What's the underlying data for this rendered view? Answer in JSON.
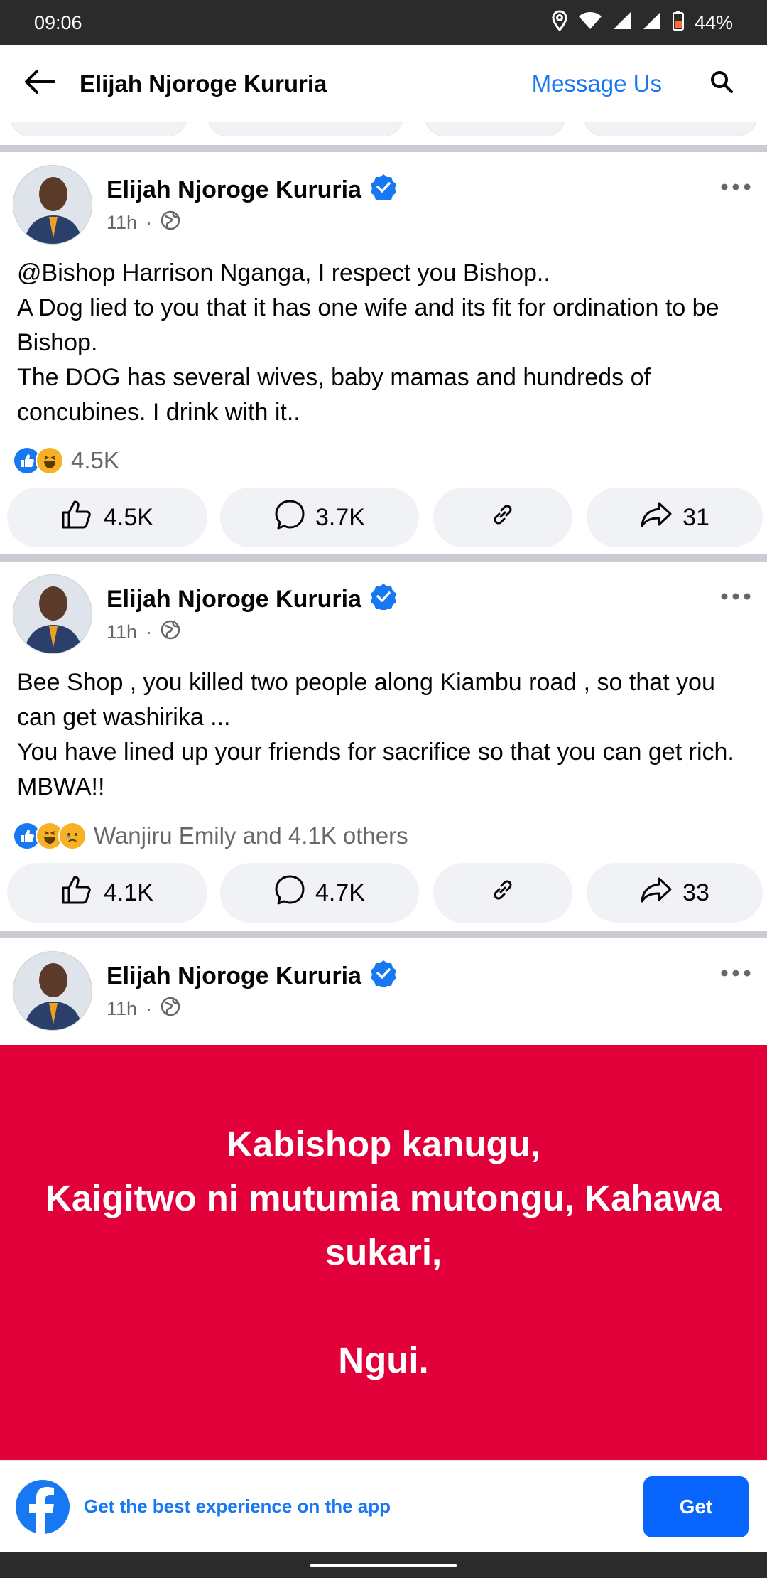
{
  "status": {
    "time": "09:06",
    "battery": "44%"
  },
  "header": {
    "title": "Elijah Njoroge Kururia",
    "message_label": "Message Us"
  },
  "posts": [
    {
      "author": "Elijah Njoroge Kururia",
      "time": "11h",
      "text": "@Bishop Harrison Nganga, I respect you Bishop..\nA Dog lied to you that it has one wife and its fit for ordination to be Bishop.\nThe DOG has several wives, baby mamas and hundreds  of concubines. I drink with it..",
      "reaction_summary": "4.5K",
      "likes": "4.5K",
      "comments": "3.7K",
      "shares": "31"
    },
    {
      "author": "Elijah Njoroge Kururia",
      "time": "11h",
      "text": "Bee Shop , you killed two people along Kiambu road , so that you can get washirika ...\nYou have lined up your friends for sacrifice so that you can get rich. MBWA!!",
      "reaction_summary": "Wanjiru Emily and 4.1K others",
      "likes": "4.1K",
      "comments": "4.7K",
      "shares": "33"
    },
    {
      "author": "Elijah Njoroge Kururia",
      "time": "11h",
      "card_text": "Kabishop kanugu,\nKaigitwo ni mutumia mutongu, Kahawa sukari,\n\nNgui.",
      "card_color": "#e2003b"
    }
  ],
  "app_banner": {
    "text": "Get the best experience on the app",
    "button": "Get"
  },
  "colors": {
    "accent": "#1877f2",
    "like_blue": "#1877f2",
    "haha_yellow": "#f7b125"
  }
}
